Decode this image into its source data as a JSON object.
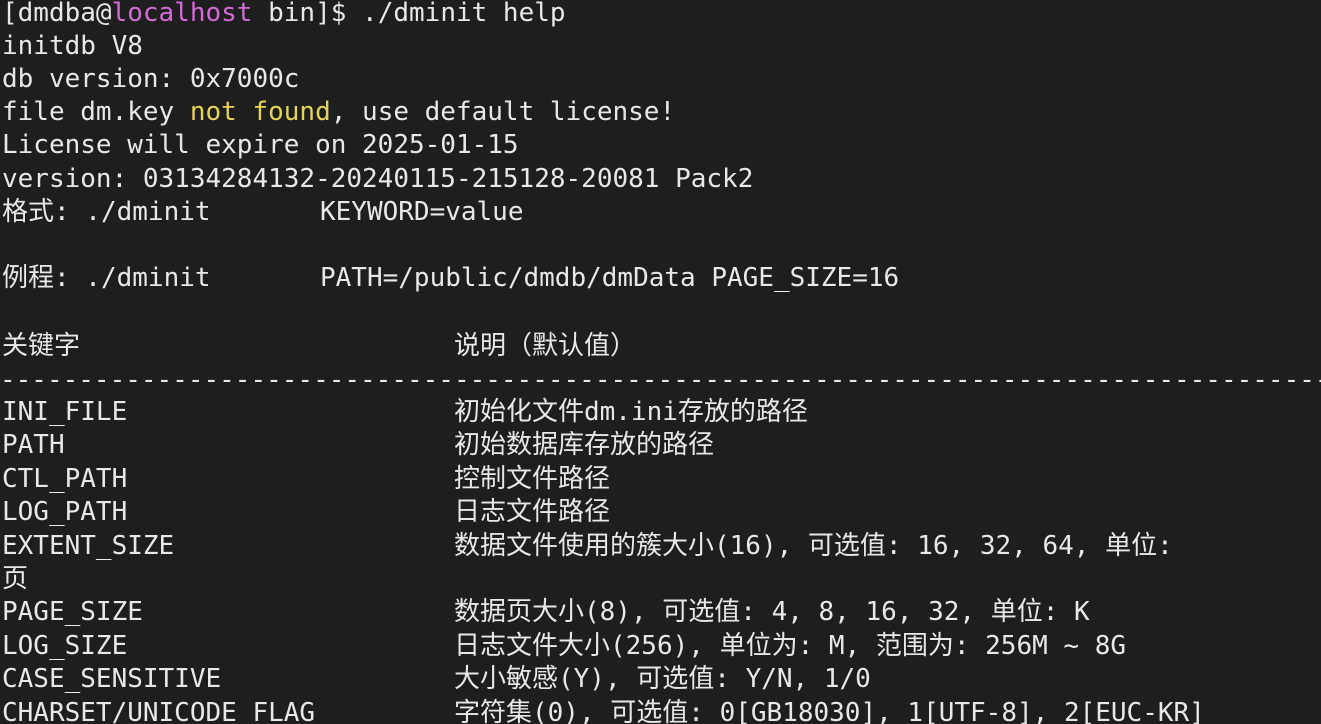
{
  "prompt": {
    "open_bracket": "[dmdba@",
    "host": "localhost",
    "rest": " bin]$ ",
    "command": "./dminit help"
  },
  "header_lines": [
    "initdb V8",
    "db version: 0x7000c"
  ],
  "license_line": {
    "pre": "file dm.key ",
    "highlight": "not found",
    "post": ", use default license!"
  },
  "info_lines": [
    "License will expire on 2025-01-15",
    "version: 03134284132-20240115-215128-20081 Pack2"
  ],
  "format_line": {
    "label": "格式: ./dminit",
    "value": "KEYWORD=value"
  },
  "example_line": {
    "label": "例程: ./dminit",
    "value": "PATH=/public/dmdb/dmData PAGE_SIZE=16"
  },
  "table_header": {
    "keyword": "关键字",
    "description": "说明（默认值）"
  },
  "dashes": "------------------------------------------------------------------------------------------------------------------------",
  "rows": [
    {
      "keyword": "INI_FILE",
      "description": "初始化文件dm.ini存放的路径"
    },
    {
      "keyword": "PATH",
      "description": "初始数据库存放的路径"
    },
    {
      "keyword": "CTL_PATH",
      "description": "控制文件路径"
    },
    {
      "keyword": "LOG_PATH",
      "description": "日志文件路径"
    },
    {
      "keyword": "EXTENT_SIZE",
      "description": "数据文件使用的簇大小(16), 可选值: 16, 32, 64, 单位:"
    },
    {
      "keyword": "页",
      "description": ""
    },
    {
      "keyword": "PAGE_SIZE",
      "description": "数据页大小(8), 可选值: 4, 8, 16, 32, 单位: K"
    },
    {
      "keyword": "LOG_SIZE",
      "description": "日志文件大小(256), 单位为: M, 范围为: 256M ~ 8G"
    },
    {
      "keyword": "CASE_SENSITIVE",
      "description": "大小敏感(Y), 可选值: Y/N, 1/0"
    },
    {
      "keyword": "CHARSET/UNICODE_FLAG",
      "description": "字符集(0), 可选值: 0[GB18030], 1[UTF-8], 2[EUC-KR]"
    }
  ],
  "colors": {
    "background": "#1e1e1e",
    "foreground": "#e8e8e8",
    "host": "#d36bd6",
    "warning": "#e5d35a"
  }
}
